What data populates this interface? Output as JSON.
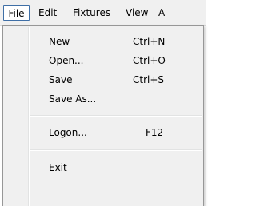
{
  "menubar": {
    "items": [
      {
        "label": "File"
      },
      {
        "label": "Edit"
      },
      {
        "label": "Fixtures"
      },
      {
        "label": "View"
      },
      {
        "label": "A"
      }
    ]
  },
  "file_menu": {
    "items": [
      {
        "label": "New",
        "shortcut": "Ctrl+N"
      },
      {
        "label": "Open...",
        "shortcut": "Ctrl+O"
      },
      {
        "label": "Save",
        "shortcut": "Ctrl+S"
      },
      {
        "label": "Save As...",
        "shortcut": ""
      },
      {
        "label": "Logon...",
        "shortcut": "F12"
      },
      {
        "label": "Exit",
        "shortcut": ""
      }
    ]
  }
}
